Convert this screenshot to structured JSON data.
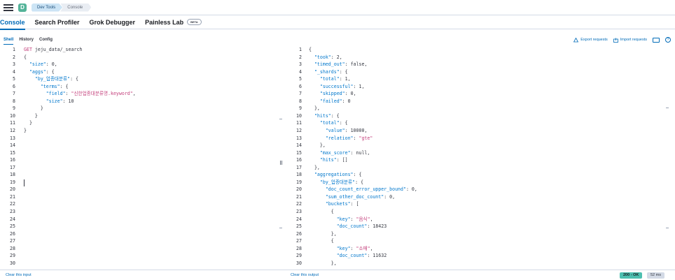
{
  "header": {
    "logo_letter": "D",
    "breadcrumbs": [
      "Dev Tools",
      "Console"
    ]
  },
  "tabs": [
    {
      "label": "Console",
      "selected": true
    },
    {
      "label": "Search Profiler"
    },
    {
      "label": "Grok Debugger"
    },
    {
      "label": "Painless Lab",
      "badge": "BETA"
    }
  ],
  "subtabs": [
    {
      "label": "Shell",
      "selected": true
    },
    {
      "label": "History"
    },
    {
      "label": "Config"
    }
  ],
  "actions": {
    "export": "Export requests",
    "import": "Import requests"
  },
  "request": {
    "line_count": 30,
    "lines": [
      [
        [
          "method",
          "GET"
        ],
        [
          "path",
          " jeju_data/_search"
        ]
      ],
      [
        [
          "punc",
          "{"
        ]
      ],
      [
        [
          "punc",
          "  "
        ],
        [
          "key",
          "\"size\""
        ],
        [
          "punc",
          ": "
        ],
        [
          "num",
          "0"
        ],
        [
          "punc",
          ","
        ]
      ],
      [
        [
          "punc",
          "  "
        ],
        [
          "key",
          "\"aggs\""
        ],
        [
          "punc",
          ": {"
        ]
      ],
      [
        [
          "punc",
          "    "
        ],
        [
          "key",
          "\"by_업종대분류\""
        ],
        [
          "punc",
          ": {"
        ]
      ],
      [
        [
          "punc",
          "      "
        ],
        [
          "key",
          "\"terms\""
        ],
        [
          "punc",
          ": {"
        ]
      ],
      [
        [
          "punc",
          "        "
        ],
        [
          "key",
          "\"field\""
        ],
        [
          "punc",
          ": "
        ],
        [
          "str",
          "\"신한업종대분류명.keyword\""
        ],
        [
          "punc",
          ","
        ]
      ],
      [
        [
          "punc",
          "        "
        ],
        [
          "key",
          "\"size\""
        ],
        [
          "punc",
          ": "
        ],
        [
          "num",
          "10"
        ]
      ],
      [
        [
          "punc",
          "      }"
        ]
      ],
      [
        [
          "punc",
          "    }"
        ]
      ],
      [
        [
          "punc",
          "  }"
        ]
      ],
      [
        [
          "punc",
          "}"
        ]
      ]
    ]
  },
  "response": {
    "line_count": 30,
    "lines": [
      [
        [
          "punc",
          "{"
        ]
      ],
      [
        [
          "punc",
          "  "
        ],
        [
          "key",
          "\"took\""
        ],
        [
          "punc",
          ": "
        ],
        [
          "num",
          "2"
        ],
        [
          "punc",
          ","
        ]
      ],
      [
        [
          "punc",
          "  "
        ],
        [
          "key",
          "\"timed_out\""
        ],
        [
          "punc",
          ": "
        ],
        [
          "kw",
          "false"
        ],
        [
          "punc",
          ","
        ]
      ],
      [
        [
          "punc",
          "  "
        ],
        [
          "key",
          "\"_shards\""
        ],
        [
          "punc",
          ": {"
        ]
      ],
      [
        [
          "punc",
          "    "
        ],
        [
          "key",
          "\"total\""
        ],
        [
          "punc",
          ": "
        ],
        [
          "num",
          "1"
        ],
        [
          "punc",
          ","
        ]
      ],
      [
        [
          "punc",
          "    "
        ],
        [
          "key",
          "\"successful\""
        ],
        [
          "punc",
          ": "
        ],
        [
          "num",
          "1"
        ],
        [
          "punc",
          ","
        ]
      ],
      [
        [
          "punc",
          "    "
        ],
        [
          "key",
          "\"skipped\""
        ],
        [
          "punc",
          ": "
        ],
        [
          "num",
          "0"
        ],
        [
          "punc",
          ","
        ]
      ],
      [
        [
          "punc",
          "    "
        ],
        [
          "key",
          "\"failed\""
        ],
        [
          "punc",
          ": "
        ],
        [
          "num",
          "0"
        ]
      ],
      [
        [
          "punc",
          "  },"
        ]
      ],
      [
        [
          "punc",
          "  "
        ],
        [
          "key",
          "\"hits\""
        ],
        [
          "punc",
          ": {"
        ]
      ],
      [
        [
          "punc",
          "    "
        ],
        [
          "key",
          "\"total\""
        ],
        [
          "punc",
          ": {"
        ]
      ],
      [
        [
          "punc",
          "      "
        ],
        [
          "key",
          "\"value\""
        ],
        [
          "punc",
          ": "
        ],
        [
          "num",
          "10000"
        ],
        [
          "punc",
          ","
        ]
      ],
      [
        [
          "punc",
          "      "
        ],
        [
          "key",
          "\"relation\""
        ],
        [
          "punc",
          ": "
        ],
        [
          "str",
          "\"gte\""
        ]
      ],
      [
        [
          "punc",
          "    },"
        ]
      ],
      [
        [
          "punc",
          "    "
        ],
        [
          "key",
          "\"max_score\""
        ],
        [
          "punc",
          ": "
        ],
        [
          "kw",
          "null"
        ],
        [
          "punc",
          ","
        ]
      ],
      [
        [
          "punc",
          "    "
        ],
        [
          "key",
          "\"hits\""
        ],
        [
          "punc",
          ": []"
        ]
      ],
      [
        [
          "punc",
          "  },"
        ]
      ],
      [
        [
          "punc",
          "  "
        ],
        [
          "key",
          "\"aggregations\""
        ],
        [
          "punc",
          ": {"
        ]
      ],
      [
        [
          "punc",
          "    "
        ],
        [
          "key",
          "\"by_업종대분류\""
        ],
        [
          "punc",
          ": {"
        ]
      ],
      [
        [
          "punc",
          "      "
        ],
        [
          "key",
          "\"doc_count_error_upper_bound\""
        ],
        [
          "punc",
          ": "
        ],
        [
          "num",
          "0"
        ],
        [
          "punc",
          ","
        ]
      ],
      [
        [
          "punc",
          "      "
        ],
        [
          "key",
          "\"sum_other_doc_count\""
        ],
        [
          "punc",
          ": "
        ],
        [
          "num",
          "0"
        ],
        [
          "punc",
          ","
        ]
      ],
      [
        [
          "punc",
          "      "
        ],
        [
          "key",
          "\"buckets\""
        ],
        [
          "punc",
          ": ["
        ]
      ],
      [
        [
          "punc",
          "        {"
        ]
      ],
      [
        [
          "punc",
          "          "
        ],
        [
          "key",
          "\"key\""
        ],
        [
          "punc",
          ": "
        ],
        [
          "str",
          "\"음식\""
        ],
        [
          "punc",
          ","
        ]
      ],
      [
        [
          "punc",
          "          "
        ],
        [
          "key",
          "\"doc_count\""
        ],
        [
          "punc",
          ": "
        ],
        [
          "num",
          "18423"
        ]
      ],
      [
        [
          "punc",
          "        },"
        ]
      ],
      [
        [
          "punc",
          "        {"
        ]
      ],
      [
        [
          "punc",
          "          "
        ],
        [
          "key",
          "\"key\""
        ],
        [
          "punc",
          ": "
        ],
        [
          "str",
          "\"소매\""
        ],
        [
          "punc",
          ","
        ]
      ],
      [
        [
          "punc",
          "          "
        ],
        [
          "key",
          "\"doc_count\""
        ],
        [
          "punc",
          ": "
        ],
        [
          "num",
          "11632"
        ]
      ],
      [
        [
          "punc",
          "        },"
        ]
      ]
    ]
  },
  "footer": {
    "clear_input": "Clear this input",
    "clear_output": "Clear this output",
    "status": "200 - OK",
    "time": "52 ms"
  },
  "colors": {
    "accent": "#006bb8",
    "status_ok": "#4dbfb0",
    "string": "#c4407c",
    "key": "#0077cc"
  },
  "icons": [
    "menu-icon",
    "export-icon",
    "import-icon",
    "keyboard-icon",
    "help-icon"
  ]
}
